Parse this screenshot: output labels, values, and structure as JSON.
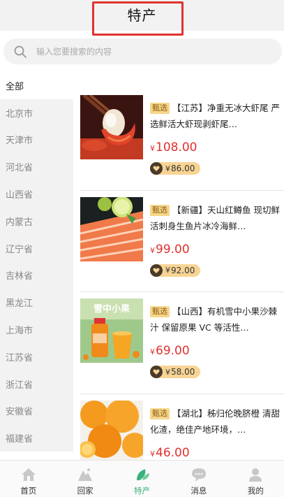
{
  "header": {
    "title": "特产"
  },
  "search": {
    "placeholder": "输入您要搜索的内容"
  },
  "sidebar": {
    "items": [
      {
        "label": "全部"
      },
      {
        "label": "北京市"
      },
      {
        "label": "天津市"
      },
      {
        "label": "河北省"
      },
      {
        "label": "山西省"
      },
      {
        "label": "内蒙古"
      },
      {
        "label": "辽宁省"
      },
      {
        "label": "吉林省"
      },
      {
        "label": "黑龙江"
      },
      {
        "label": "上海市"
      },
      {
        "label": "江苏省"
      },
      {
        "label": "浙江省"
      },
      {
        "label": "安徽省"
      },
      {
        "label": "福建省"
      }
    ]
  },
  "products": [
    {
      "tag": "甄选",
      "name": "【江苏】净重无冰大虾尾 严选鲜活大虾现剥虾尾…",
      "price_symbol": "¥",
      "price": "108.00",
      "member_symbol": "¥",
      "member_price": "86.00"
    },
    {
      "tag": "甄选",
      "name": "【新疆】天山红鳟鱼 现切鲜活刺身生鱼片冰冷海鲜…",
      "price_symbol": "¥",
      "price": "99.00",
      "member_symbol": "¥",
      "member_price": "92.00"
    },
    {
      "tag": "甄选",
      "name": "【山西】有机雪中小果沙棘汁 保留原果 VC 等活性…",
      "price_symbol": "¥",
      "price": "69.00",
      "member_symbol": "¥",
      "member_price": "58.00",
      "image_text": "雪中小果"
    },
    {
      "tag": "甄选",
      "name": "【湖北】秭归伦晚脐橙 清甜化渣，绝佳产地环境，…",
      "price_symbol": "¥",
      "price": "46.00"
    }
  ],
  "tabbar": {
    "tabs": [
      {
        "label": "首页"
      },
      {
        "label": "回家"
      },
      {
        "label": "特产"
      },
      {
        "label": "消息"
      },
      {
        "label": "我的"
      }
    ]
  },
  "colors": {
    "accent": "#3bb27a",
    "price": "#e0322f",
    "tag": "#f6d68a",
    "member_badge": "#f8d494"
  }
}
